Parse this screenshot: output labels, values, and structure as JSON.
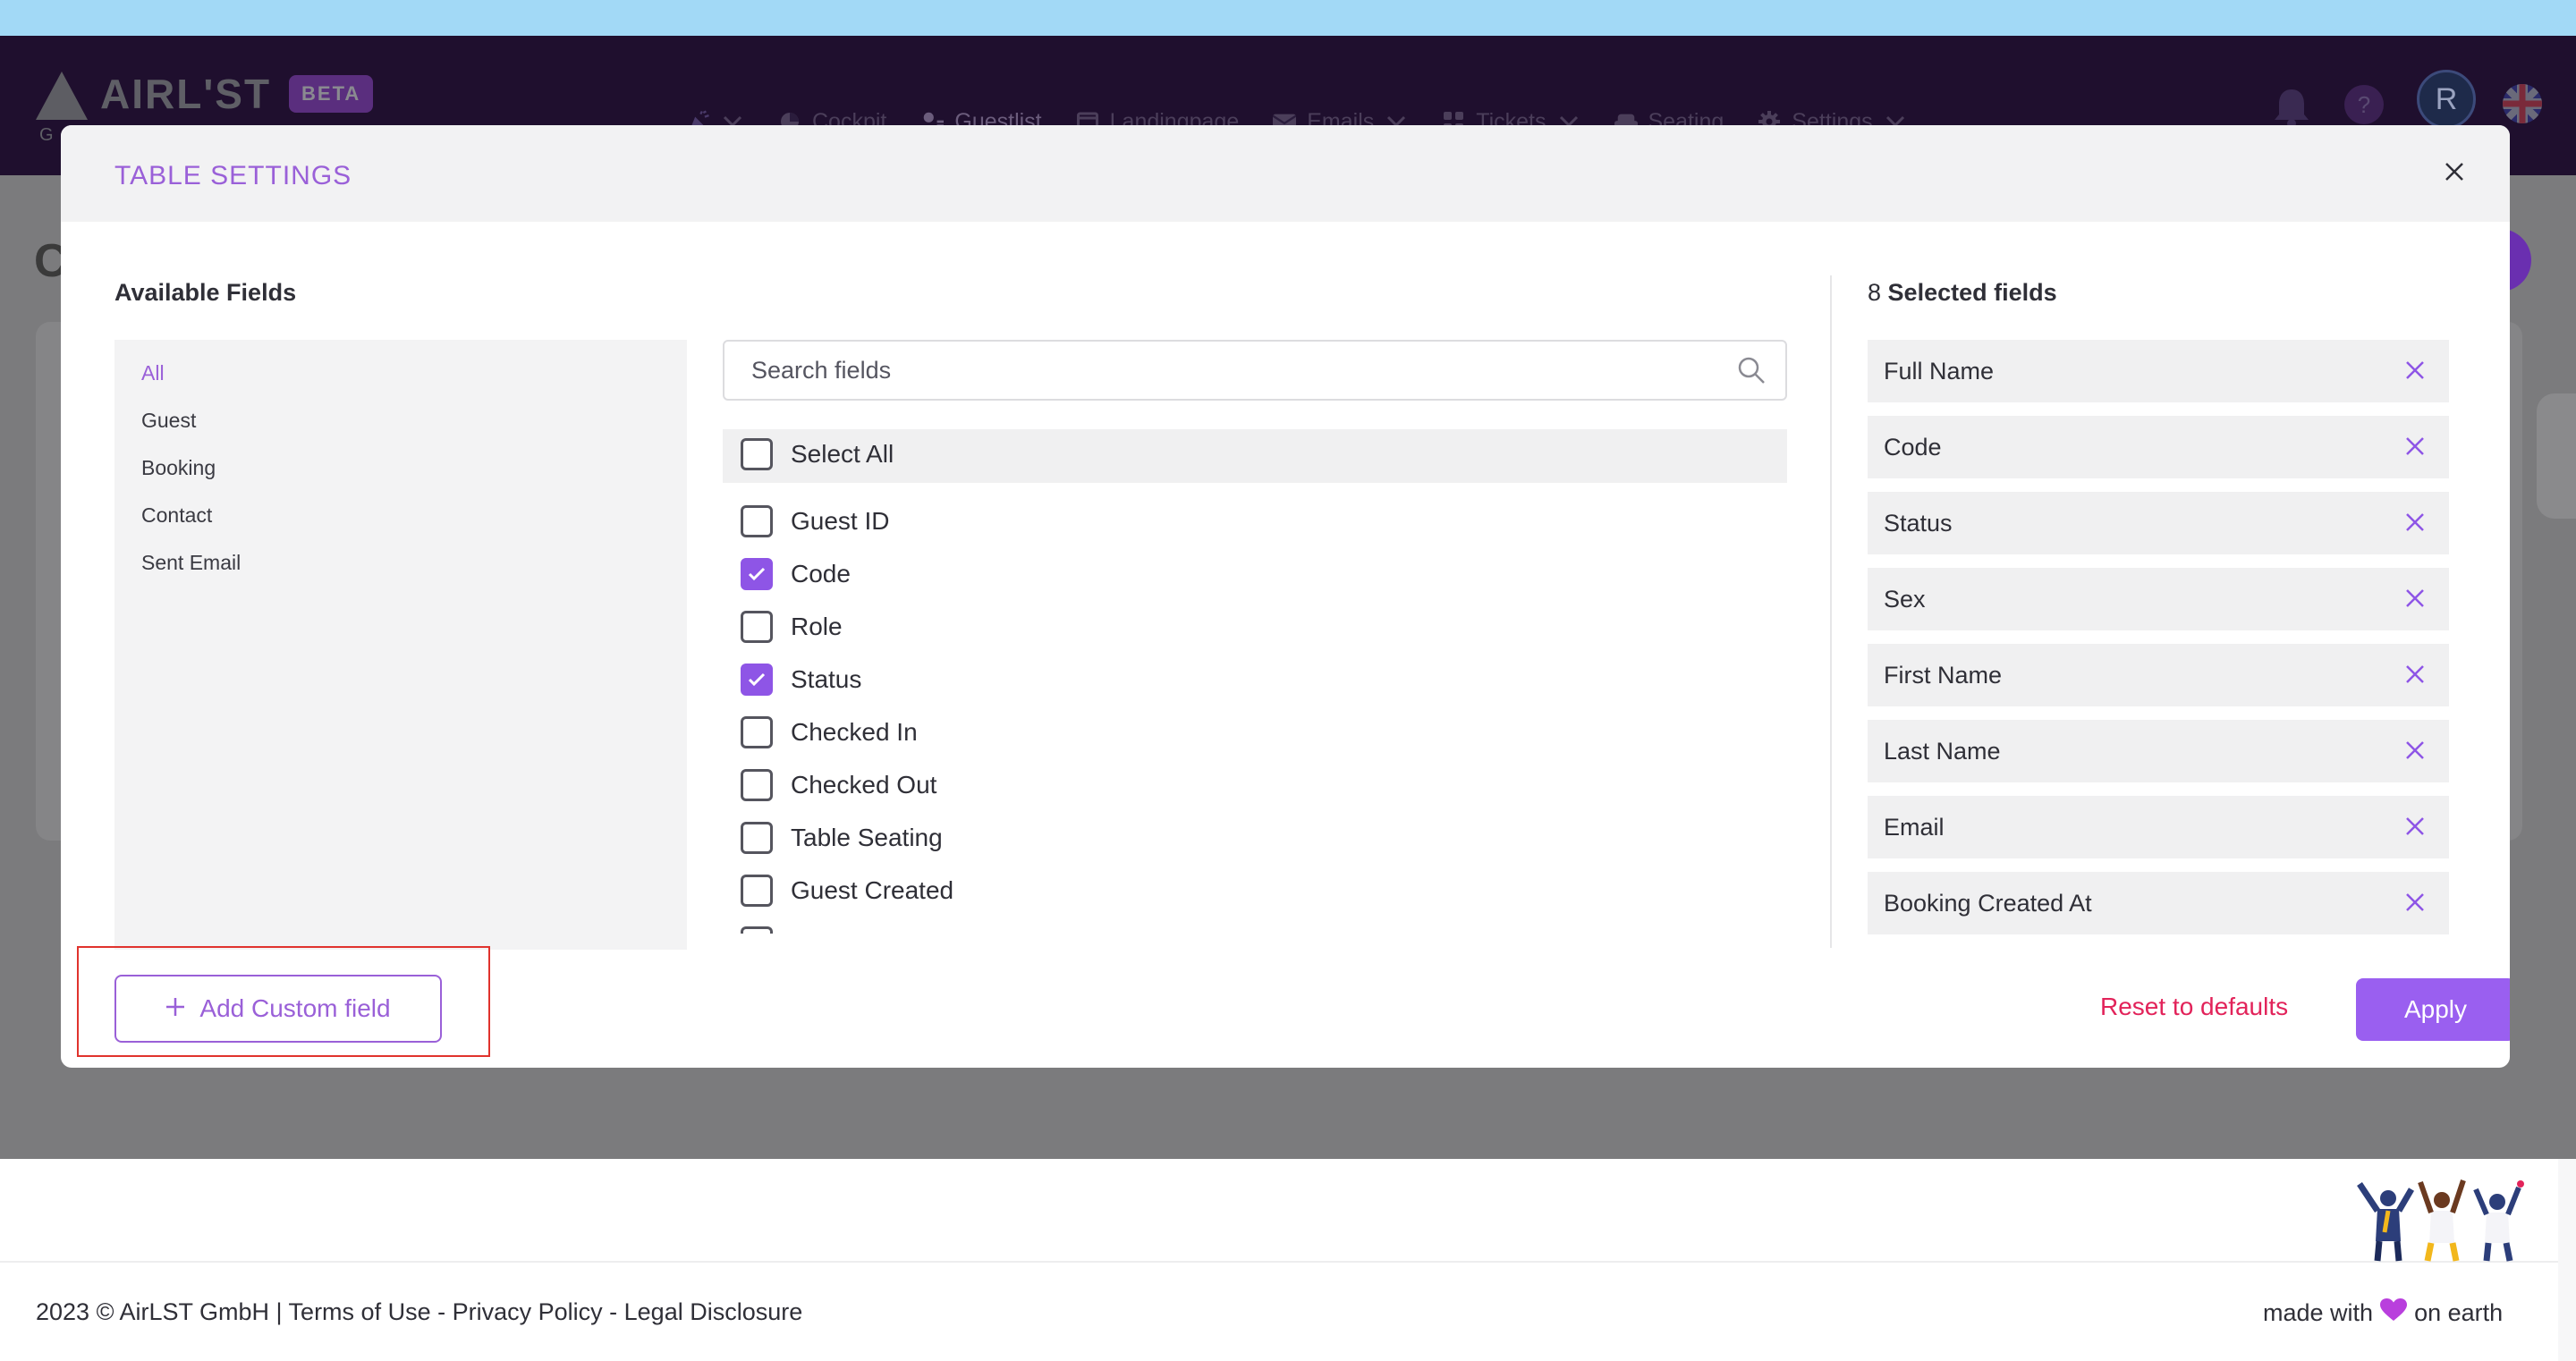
{
  "app": {
    "logo_text": "AIRL'ST",
    "logo_badge": "BETA",
    "logo_sub": "G",
    "colors": {
      "accent": "#9a60d8",
      "apply": "#9a5ff0",
      "danger": "#e2235a",
      "nav_bg": "#1f0f2e"
    }
  },
  "nav": {
    "items": [
      {
        "label": "",
        "icon": "party-popper-icon"
      },
      {
        "label": "Cockpit",
        "icon": "chart-pie-icon"
      },
      {
        "label": "Guestlist",
        "icon": "user-list-icon"
      },
      {
        "label": "Landingpage",
        "icon": "browser-window-icon"
      },
      {
        "label": "Emails",
        "icon": "envelope-icon"
      },
      {
        "label": "Tickets",
        "icon": "grid-icon"
      },
      {
        "label": "Seating",
        "icon": "sofa-icon"
      },
      {
        "label": "Settings",
        "icon": "gear-icon"
      }
    ],
    "avatar_initial": "R"
  },
  "background": {
    "ghost_letter": "C"
  },
  "modal": {
    "title": "TABLE SETTINGS",
    "available_title": "Available Fields",
    "selected_count": "8",
    "selected_title": "Selected fields",
    "categories": [
      "All",
      "Guest",
      "Booking",
      "Contact",
      "Sent Email"
    ],
    "active_category": "All",
    "search": {
      "placeholder": "Search fields",
      "value": ""
    },
    "select_all_label": "Select All",
    "fields": [
      {
        "label": "Guest ID",
        "checked": false
      },
      {
        "label": "Code",
        "checked": true
      },
      {
        "label": "Role",
        "checked": false
      },
      {
        "label": "Status",
        "checked": true
      },
      {
        "label": "Checked In",
        "checked": false
      },
      {
        "label": "Checked Out",
        "checked": false
      },
      {
        "label": "Table Seating",
        "checked": false
      },
      {
        "label": "Guest Created",
        "checked": false
      }
    ],
    "selected_fields": [
      "Full Name",
      "Code",
      "Status",
      "Sex",
      "First Name",
      "Last Name",
      "Email",
      "Booking Created At"
    ],
    "add_custom_label": "Add Custom field",
    "reset_label": "Reset to defaults",
    "apply_label": "Apply"
  },
  "footer": {
    "copyright": "2023 © AirLST GmbH | ",
    "terms": "Terms of Use",
    "sep1": " - ",
    "privacy": "Privacy Policy",
    "sep2": " - ",
    "legal": "Legal Disclosure",
    "made_with": "made with",
    "on_earth": "on earth"
  }
}
